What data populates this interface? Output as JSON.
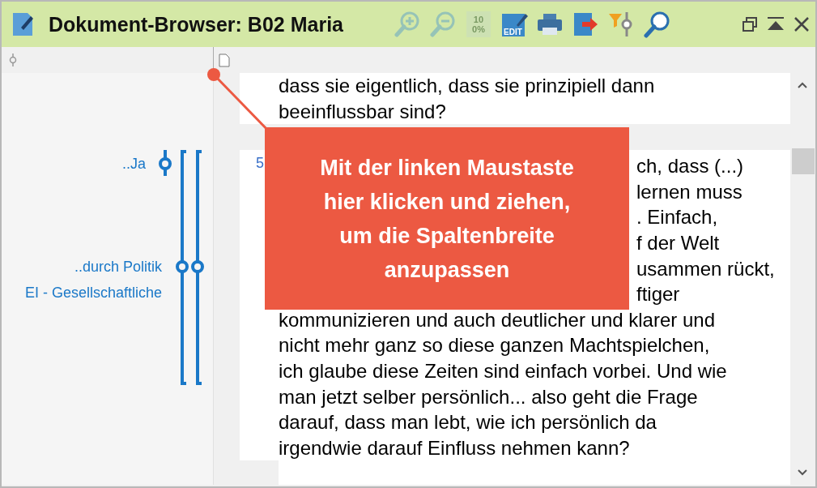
{
  "window": {
    "title": "Dokument-Browser: B02 Maria"
  },
  "toolbar": [
    {
      "kind": "zoom-in",
      "disabled": true
    },
    {
      "kind": "zoom-out",
      "disabled": true
    },
    {
      "kind": "zoom-100",
      "label": "100%",
      "disabled": true
    },
    {
      "kind": "edit",
      "label": "EDIT",
      "disabled": false
    },
    {
      "kind": "print",
      "disabled": false
    },
    {
      "kind": "export",
      "disabled": false
    },
    {
      "kind": "filter",
      "disabled": false
    },
    {
      "kind": "search",
      "disabled": false
    }
  ],
  "window_controls": [
    {
      "kind": "restore"
    },
    {
      "kind": "collapse"
    },
    {
      "kind": "close"
    }
  ],
  "code_labels": [
    "..Ja",
    "..durch Politik",
    "EI - Gesellschaftliche"
  ],
  "document": {
    "paragraphs": [
      {
        "lines": [
          "dass sie eigentlich, dass sie prinzipiell dann",
          "beeinflussbar sind?"
        ]
      },
      {
        "number": "5",
        "line_ends": [
          "ch, dass (...)",
          "lernen muss",
          ". Einfach,",
          "f der Welt",
          "usammen rückt,",
          "ftiger"
        ],
        "lines": [
          "kommunizieren und auch deutlicher und klarer und",
          "nicht mehr ganz so diese ganzen Machtspielchen,",
          "ich glaube diese Zeiten sind einfach vorbei. Und wie",
          "man jetzt selber persönlich... also geht die Frage",
          "darauf, dass man lebt, wie ich persönlich da",
          "irgendwie darauf Einfluss nehmen kann?"
        ]
      }
    ]
  },
  "callout": {
    "lines": [
      "Mit der linken Maustaste",
      "hier klicken und ziehen,",
      "um die Spaltenbreite",
      "anzupassen"
    ]
  }
}
